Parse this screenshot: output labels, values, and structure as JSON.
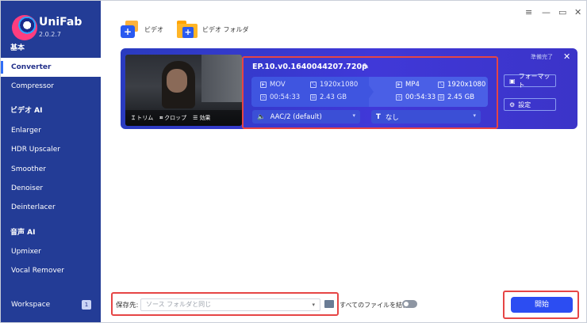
{
  "app": {
    "brand": "UniFab",
    "version": "2.0.2.7"
  },
  "sidebar": {
    "basic_section": "基本",
    "items_basic": [
      "Converter",
      "Compressor"
    ],
    "video_ai_section": "ビデオ AI",
    "items_video_ai": [
      "Enlarger",
      "HDR Upscaler",
      "Smoother",
      "Denoiser",
      "Deinterlacer"
    ],
    "audio_ai_section": "音声 AI",
    "items_audio_ai": [
      "Upmixer",
      "Vocal Remover"
    ],
    "workspace": {
      "label": "Workspace",
      "count": "1"
    }
  },
  "toolbar": {
    "add_video": "ビデオ",
    "add_folder": "ビデオ フォルダ"
  },
  "window": {
    "menu_icon": "≡",
    "min_icon": "—",
    "max_icon": "▭",
    "close_icon": "✕"
  },
  "task": {
    "filename": "EP.10.v0.1640044207.720p",
    "status": "準備完了",
    "thumb_tools": [
      "トリム",
      "クロップ",
      "効果"
    ],
    "source": {
      "format": "MOV",
      "resolution": "1920x1080",
      "duration": "00:54:33",
      "size": "2.43 GB"
    },
    "target": {
      "format": "MP4",
      "resolution": "1920x1080",
      "duration": "00:54:33",
      "size": "2.45 GB"
    },
    "audio": "AAC/2 (default)",
    "subtitle": "なし",
    "format_btn": "フォーマット",
    "settings_btn": "設定"
  },
  "footer": {
    "save_label": "保存先:",
    "save_placeholder": "ソース フォルダと同じ",
    "merge_label": "すべてのファイルを結合",
    "start_btn": "開始"
  },
  "colors": {
    "sidebar": "#233c96",
    "card": "#3b3bd0",
    "accent": "#2c4df2",
    "highlight": "#e64545"
  }
}
